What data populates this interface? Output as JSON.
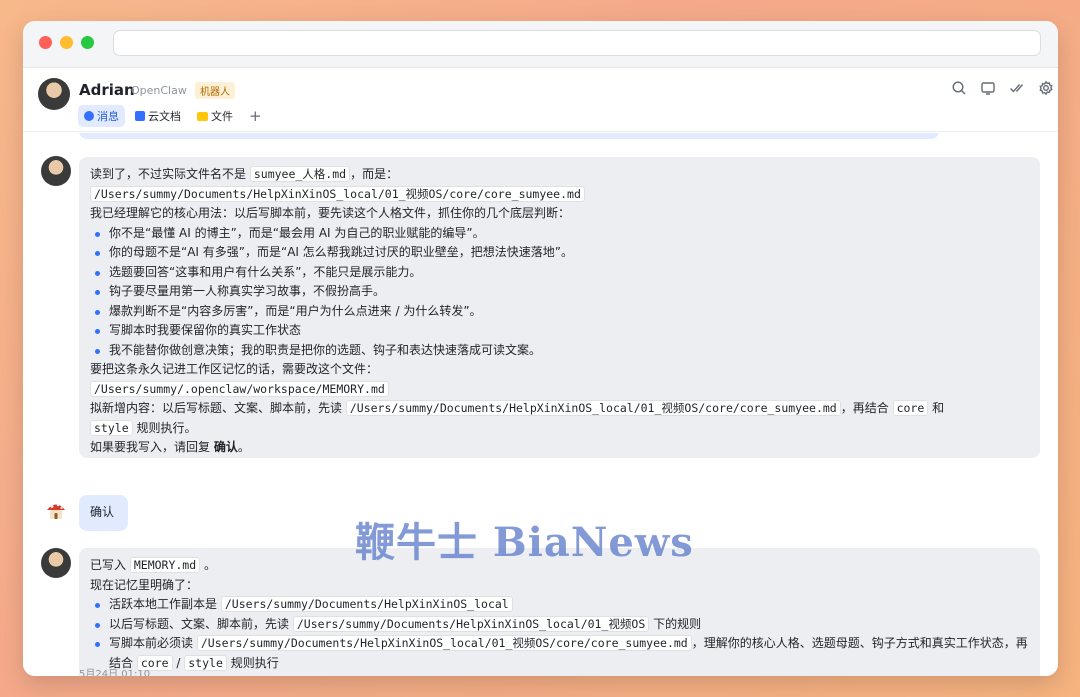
{
  "header": {
    "name": "Adrian",
    "subtitle": "OpenClaw",
    "badge": "机器人",
    "tabs": [
      {
        "label": "消息"
      },
      {
        "label": "云文档"
      },
      {
        "label": "文件"
      }
    ],
    "add_tab": "+"
  },
  "messages": {
    "m1": {
      "line1_a": "读到了，不过实际文件名不是",
      "line1_code": "sumyee_人格.md",
      "line1_b": "，而是：",
      "path_code": "/Users/summy/Documents/HelpXinXinOS_local/01_视频OS/core/core_sumyee.md",
      "intro": "我已经理解它的核心用法：以后写脚本前，要先读这个人格文件，抓住你的几个底层判断：",
      "bullets": [
        "你不是“最懂 AI 的博主”，而是“最会用 AI 为自己的职业赋能的编导”。",
        "你的母题不是“AI 有多强”，而是“AI 怎么帮我跳过讨厌的职业壁垒，把想法快速落地”。",
        "选题要回答“这事和用户有什么关系”，不能只是展示能力。",
        "钩子要尽量用第一人称真实学习故事，不假扮高手。",
        "爆款判断不是“内容多厉害”，而是“用户为什么点进来 / 为什么转发”。",
        "写脚本时我要保留你的真实工作状态",
        "我不能替你做创意决策；我的职责是把你的选题、钩子和表达快速落成可读文案。"
      ],
      "memory_intro": "要把这条永久记进工作区记忆的话，需要改这个文件：",
      "memory_path": "/Users/summy/.openclaw/workspace/MEMORY.md",
      "plan_a": "拟新增内容：以后写标题、文案、脚本前，先读",
      "plan_code1": "/Users/summy/Documents/HelpXinXinOS_local/01_视频OS/core/core_sumyee.md",
      "plan_b": "，再结合",
      "plan_code2": "core",
      "plan_c": "和",
      "plan_code3": "style",
      "plan_d": "规则执行。",
      "reply_a": "如果要我写入，请回复",
      "reply_b": "确认",
      "reply_c": "。"
    },
    "m2": {
      "text": "确认"
    },
    "m3": {
      "line1_a": "已写入",
      "line1_code": "MEMORY.md",
      "line1_b": "。",
      "intro": "现在记忆里明确了：",
      "b1_a": "活跃本地工作副本是",
      "b1_code": "/Users/summy/Documents/HelpXinXinOS_local",
      "b2_a": "以后写标题、文案、脚本前，先读",
      "b2_code": "/Users/summy/Documents/HelpXinXinOS_local/01_视频OS",
      "b2_b": "下的规则",
      "b3_a": "写脚本前必须读",
      "b3_code": "/Users/summy/Documents/HelpXinXinOS_local/01_视频OS/core/core_sumyee.md",
      "b3_b": "，理解你的核心人格、选题母题、钩子方式和真实工作状态，再结合",
      "b3_code2": "core",
      "b3_c": "/",
      "b3_code3": "style",
      "b3_d": "规则执行",
      "timestamp": "5月24日 01:10"
    }
  },
  "watermark": "鞭牛士 BiaNews",
  "icons": {
    "search": "search-icon",
    "screen": "screen-share-icon",
    "check": "checkmark-icon",
    "settings": "gear-icon"
  }
}
